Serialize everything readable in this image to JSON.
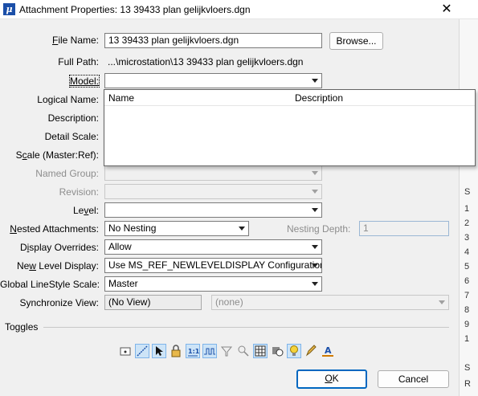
{
  "window": {
    "title": "Attachment Properties: 13 39433 plan gelijkvloers.dgn",
    "close_glyph": "✕"
  },
  "fields": {
    "file_name": {
      "label_u": "F",
      "label_rest": "ile Name:",
      "value": "13 39433 plan gelijkvloers.dgn"
    },
    "browse_label": "Browse...",
    "full_path": {
      "label": "Full Path:",
      "value": "...\\microstation\\13 39433 plan gelijkvloers.dgn"
    },
    "model": {
      "label_u": "M",
      "label_rest": "odel:",
      "value": ""
    },
    "logical_name": {
      "label_pre": "Lo",
      "label_u": "g",
      "label_rest": "ical Name:"
    },
    "description": {
      "label": "Description:"
    },
    "detail_scale": {
      "label": "Detail Scale:"
    },
    "scale": {
      "label_pre": "S",
      "label_u": "c",
      "label_rest": "ale (Master:Ref):"
    },
    "named_group": {
      "label": "Named Group:"
    },
    "revision": {
      "label": "Revision:"
    },
    "level": {
      "label_pre": "Le",
      "label_u": "v",
      "label_rest": "el:",
      "value": ""
    },
    "nested_attachments": {
      "label_u": "N",
      "label_rest": "ested Attachments:",
      "value": "No Nesting"
    },
    "nesting_depth": {
      "label": "Nesting Depth:",
      "value": "1"
    },
    "display_overrides": {
      "label_pre": "D",
      "label_u": "i",
      "label_rest": "splay Overrides:",
      "value": "Allow"
    },
    "new_level_display": {
      "label_pre": "Ne",
      "label_u": "w",
      "label_rest": " Level Display:",
      "value": "Use MS_REF_NEWLEVELDISPLAY Configuration V"
    },
    "global_linestyle_scale": {
      "label": "Global LineStyle Scale:",
      "value": "Master"
    },
    "synchronize_view": {
      "label": "Synchronize View:",
      "value": "(No View)",
      "secondary_value": "(none)"
    }
  },
  "model_dropdown": {
    "columns": [
      "Name",
      "Description"
    ]
  },
  "toggles": {
    "label": "Toggles"
  },
  "buttons": {
    "ok_u": "O",
    "ok_rest": "K",
    "cancel": "Cancel"
  },
  "side_panel": {
    "glyphs": [
      "S",
      "1",
      "2",
      "3",
      "4",
      "5",
      "6",
      "7",
      "8",
      "9",
      "1",
      "S",
      "R"
    ]
  }
}
